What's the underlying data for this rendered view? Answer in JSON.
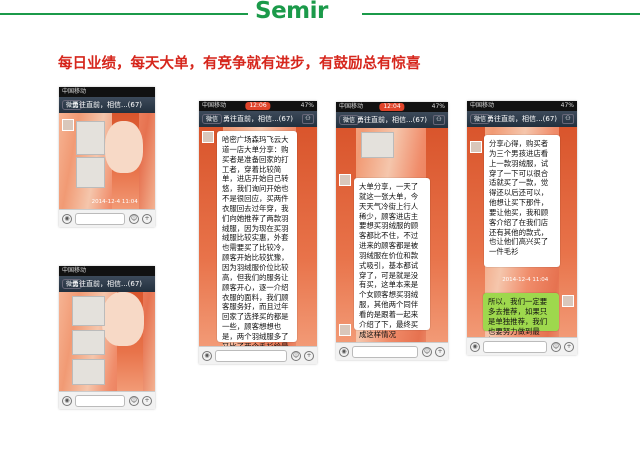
{
  "header": {
    "logo": "Semir"
  },
  "headline": "每日业绩，每天大单，有竞争就有进步，有鼓励总有惊喜",
  "phones": [
    {
      "carrier": "中国移动",
      "time": "",
      "battery": "",
      "back": "微信",
      "title": "勇往直前，相信...(67)",
      "stamp": "2014-12-4 11:04",
      "bubble": ""
    },
    {
      "carrier": "中国移动",
      "time": "",
      "battery": "",
      "back": "微信",
      "title": "勇往直前，相信...(67)",
      "stamp": "",
      "bubble": ""
    },
    {
      "carrier": "中国移动",
      "time": "12:06",
      "battery": "47%",
      "back": "微信",
      "title": "勇往直前，相信...(67)",
      "stamp": "",
      "bubble": "哈密广场森玛飞云大道一店大单分享：购买者是准备回家的打工者，穿着比较简单，进店开始自己转悠，我们询问开始也不是很回应，买两件衣服回去过年穿，我们向她推荐了两款羽绒服，因为现在买羽绒服比较实惠，外套也需要买了比较冷，顾客开始比较犹豫，因为羽绒服价位比较高，但我们的服务让顾客开心，逐一介绍衣服的面料，我们顾客服务好，而且过年回家了选择买的都是一些，顾客想想也是，两个羽绒服多了又比了两个毛衫给最终，成单四件，为"
    },
    {
      "carrier": "中国移动",
      "time": "12:04",
      "battery": "47%",
      "back": "微信",
      "title": "勇往直前，相信...(67)",
      "stamp": "",
      "bubble": "大单分享，一天了就这一张大单，今天天气冷街上行人稀少，顾客进店主要想买羽绒服的顾客都比不住，不过进来的顾客都是被羽绒服在价位和款式吸引，基本都试穿了，可是就是没有买，这单本来是个女顾客想买羽绒服，其他两个同伴看的是跟着一起来介绍了下，最终买成这样情况"
    },
    {
      "carrier": "中国移动",
      "time": "",
      "battery": "47%",
      "back": "微信",
      "title": "勇往直前，相信...(67)",
      "stamp": "2014-12-4 11:04",
      "bubble": "分享心得，购买者为三个男孩进店看上一款羽绒服，试穿了一下可以很合适就买了一款，觉得还以后还可以，他想让买下那件，要让他买，我和顾客介绍了在我们店还有其他的款式，也让他们高兴买了一件毛衫",
      "reply": "所以，我们一定要多去推荐，如果只是单独推荐，我们也要努力做到最好，"
    }
  ],
  "chat_icons": {
    "voice": "voice-icon",
    "emoji": "emoji-icon",
    "add": "plus-icon"
  }
}
